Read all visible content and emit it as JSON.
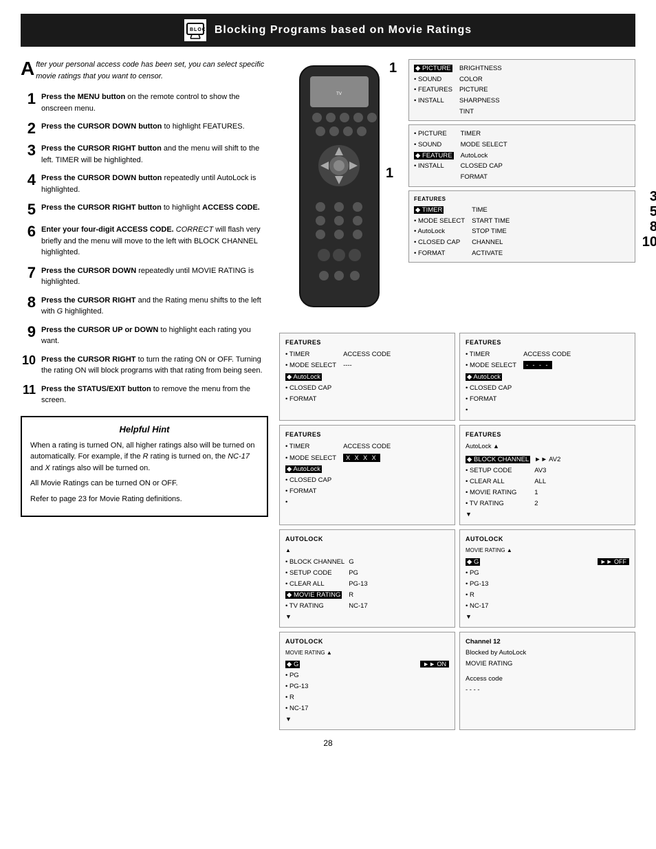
{
  "header": {
    "title": "Blocking Programs based on Movie Ratings",
    "icon_alt": "TV blocking icon"
  },
  "intro": {
    "drop_cap": "A",
    "text": "fter your personal access code has been set, you can select specific movie ratings that you want to censor."
  },
  "steps": [
    {
      "num": "1",
      "html": "<strong>Press the MENU button</strong> on the remote control to show the onscreen menu."
    },
    {
      "num": "2",
      "html": "<strong>Press the CURSOR DOWN button</strong> to highlight FEATURES."
    },
    {
      "num": "3",
      "html": "<strong>Press the CURSOR RIGHT button</strong> and the menu will shift to the left. TIMER will be highlighted."
    },
    {
      "num": "4",
      "html": "<strong>Press the CURSOR DOWN button</strong> repeatedly until AutoLock is highlighted."
    },
    {
      "num": "5",
      "html": "<strong>Press the CURSOR RIGHT button</strong> to highlight <strong>ACCESS CODE.</strong>"
    },
    {
      "num": "6",
      "html": "<strong>Enter your four-digit ACCESS CODE.</strong> <em>CORRECT</em> will flash very briefly and the menu will move to the left with BLOCK CHANNEL highlighted."
    },
    {
      "num": "7",
      "html": "<strong>Press the CURSOR DOWN</strong> repeatedly until MOVIE RATING is highlighted."
    },
    {
      "num": "8",
      "html": "<strong>Press the CURSOR RIGHT</strong> and the Rating menu shifts to the left with <em>G</em> highlighted."
    },
    {
      "num": "9",
      "html": "<strong>Press the CURSOR UP or DOWN</strong> to highlight each rating you want."
    },
    {
      "num": "10",
      "html": "<strong>Press the CURSOR RIGHT</strong> to turn the rating ON or OFF. Turning the rating ON will block programs with that rating from being seen."
    },
    {
      "num": "11",
      "html": "<strong>Press the STATUS/EXIT button</strong> to remove the menu from the screen."
    }
  ],
  "hint": {
    "title": "Helpful Hint",
    "paragraphs": [
      "When a rating is turned ON, all higher ratings also will be turned on automatically. For example, if the R rating is turned on, the NC-17 and X ratings also will be turned on.",
      "All Movie Ratings can be turned ON or OFF.",
      "Refer to page 23 for Movie Rating definitions."
    ]
  },
  "menu_panel_1": {
    "title": "PICTURE menu",
    "items_left": [
      "◆ PICTURE",
      "• SOUND",
      "• FEATURES",
      "• INSTALL"
    ],
    "items_right": [
      "BRIGHTNESS",
      "COLOR",
      "PICTURE",
      "SHARPNESS",
      "TINT"
    ],
    "selected": "PICTURE"
  },
  "menu_panel_2": {
    "title": "FEATURES highlighted",
    "items_left": [
      "• PICTURE",
      "• SOUND",
      "◆ FEATURE",
      "• INSTALL"
    ],
    "items_right": [
      "TIMER",
      "MODE SELECT",
      "AutoLock",
      "CLOSED CAP",
      "FORMAT"
    ],
    "selected": "FEATURE"
  },
  "menu_panel_3": {
    "title": "FEATURES - TIMER",
    "items_left": [
      "◆ TIMER",
      "• MODE SELECT",
      "• AutoLock",
      "• CLOSED CAP",
      "• FORMAT"
    ],
    "items_right": [
      "TIME",
      "START TIME",
      "STOP TIME",
      "CHANNEL",
      "ACTIVATE"
    ],
    "selected": "TIMER"
  },
  "menu_panel_4": {
    "title": "FEATURES - ACCESS CODE empty",
    "items_left": [
      "• TIMER",
      "• MODE SELECT",
      "◆ AutoLock",
      "• CLOSED CAP",
      "• FORMAT"
    ],
    "items_right": [
      "ACCESS CODE",
      "----"
    ],
    "selected": "AutoLock"
  },
  "menu_panel_5": {
    "title": "FEATURES - ACCESS CODE entry",
    "items_left": [
      "• TIMER",
      "• MODE SELECT",
      "◆ AutoLock",
      "• CLOSED CAP",
      "• FORMAT",
      "•"
    ],
    "items_right": [
      "ACCESS CODE",
      "- - - -"
    ],
    "selected": "AutoLock",
    "code_box": true
  },
  "menu_panel_6": {
    "title": "FEATURES - ACCESS CODE XXXX",
    "subtitle": "AutoLock",
    "items_left": [
      "• TIMER",
      "• MODE SELECT",
      "◆ AutoLock",
      "• CLOSED CAP",
      "• FORMAT",
      "•"
    ],
    "items_right": [
      "ACCESS CODE",
      "X X X X"
    ],
    "selected": "AutoLock",
    "code_value": "X X X X"
  },
  "menu_panel_7": {
    "title": "FEATURES - BLOCK CHANNEL",
    "subtitle": "AutoLock",
    "items_left": [
      "◆ BLOCK CHANNEL",
      "• SETUP CODE",
      "• CLEAR ALL",
      "• MOVIE RATING",
      "• TV RATING"
    ],
    "items_right": [
      "AV2",
      "AV3",
      "ALL",
      "1",
      "2"
    ],
    "selected": "BLOCK CHANNEL",
    "arrow_up": true,
    "arrow_down": true
  },
  "menu_panel_8": {
    "title": "AutoLock - MOVIE RATING",
    "subtitle": "MOVIE RATING",
    "items_left": [
      "• G",
      "• PG",
      "• PG-13",
      "◆ MOVIE RATING",
      "• TV RATING"
    ],
    "items_right": [
      "G",
      "PG",
      "PG-13",
      "R",
      "NC-17"
    ],
    "selected": "MOVIE RATING",
    "block_items": [
      "• BLOCK CHANNEL",
      "• SETUP CODE",
      "• CLEAR ALL",
      "◆ MOVIE RATING",
      "• TV RATING"
    ],
    "rating_vals": [
      "G",
      "PG",
      "PG-13",
      "R",
      "NC-17"
    ]
  },
  "menu_panel_9": {
    "title": "AutoLock - MOVIE RATING G=OFF",
    "subtitle": "AutoLock / MOVIE RATING",
    "g_label": "◆ G",
    "g_value": "►► OFF",
    "items": [
      "• PG",
      "• PG-13",
      "• R",
      "• NC-17"
    ],
    "selected": "G"
  },
  "menu_panel_10": {
    "title": "AutoLock - MOVIE RATING G=ON",
    "subtitle": "AutoLock / MOVIE RATING",
    "g_label": "◆ G",
    "g_value": "►► ON",
    "items": [
      "• PG",
      "• PG-13",
      "• R",
      "• NC-17"
    ],
    "selected": "G"
  },
  "menu_panel_11": {
    "title": "Channel blocked",
    "lines": [
      "Channel 12",
      "Blocked by AutoLock",
      "MOVIE RATING",
      "",
      "Access code",
      "- - - -"
    ]
  },
  "page_number": "28",
  "step_labels": {
    "s1": "1",
    "s2": "2",
    "s3": "3",
    "s4": "4",
    "s5": "5",
    "s6": "6",
    "s7": "7",
    "s8": "8",
    "s9": "9",
    "s10": "10",
    "s11": "11"
  }
}
